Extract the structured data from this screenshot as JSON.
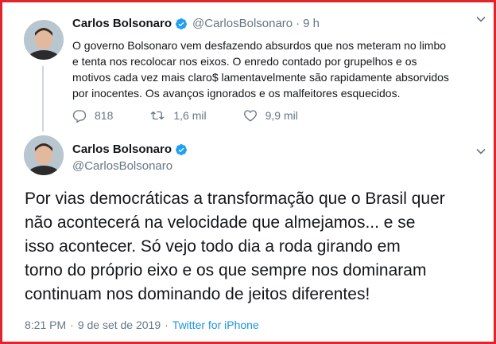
{
  "quoted_tweet": {
    "display_name": "Carlos Bolsonaro",
    "handle": "@CarlosBolsonaro",
    "separator": "·",
    "time": "9 h",
    "text": "O governo Bolsonaro vem desfazendo absurdos que nos meteram no limbo\ne tenta nos recolocar nos eixos. O enredo contado por grupelhos e os\nmotivos cada vez mais claro$ lamentavelmente são rapidamente absorvidos\npor inocentes. Os avanços ignorados e os malfeitores esquecidos.",
    "actions": {
      "replies": "818",
      "retweets": "1,6 mil",
      "likes": "9,9 mil"
    }
  },
  "main_tweet": {
    "display_name": "Carlos Bolsonaro",
    "handle": "@CarlosBolsonaro",
    "text": "Por vias democráticas a transformação que o Brasil quer\nnão acontecerá na velocidade que almejamos... e se\nisso acontecer. Só vejo todo dia a roda girando em\ntorno do próprio eixo e os que sempre nos dominaram\ncontinuam nos dominando de jeitos diferentes!",
    "time": "8:21 PM",
    "separator": "·",
    "date": "9 de set de 2019",
    "separator2": "·",
    "source": "Twitter for iPhone"
  },
  "colors": {
    "border": "#e0262c",
    "verified": "#1da1f2",
    "link": "#1b95e0",
    "muted": "#657786"
  },
  "icons": [
    "verified-badge-icon",
    "chevron-down-icon",
    "reply-icon",
    "retweet-icon",
    "like-icon"
  ]
}
